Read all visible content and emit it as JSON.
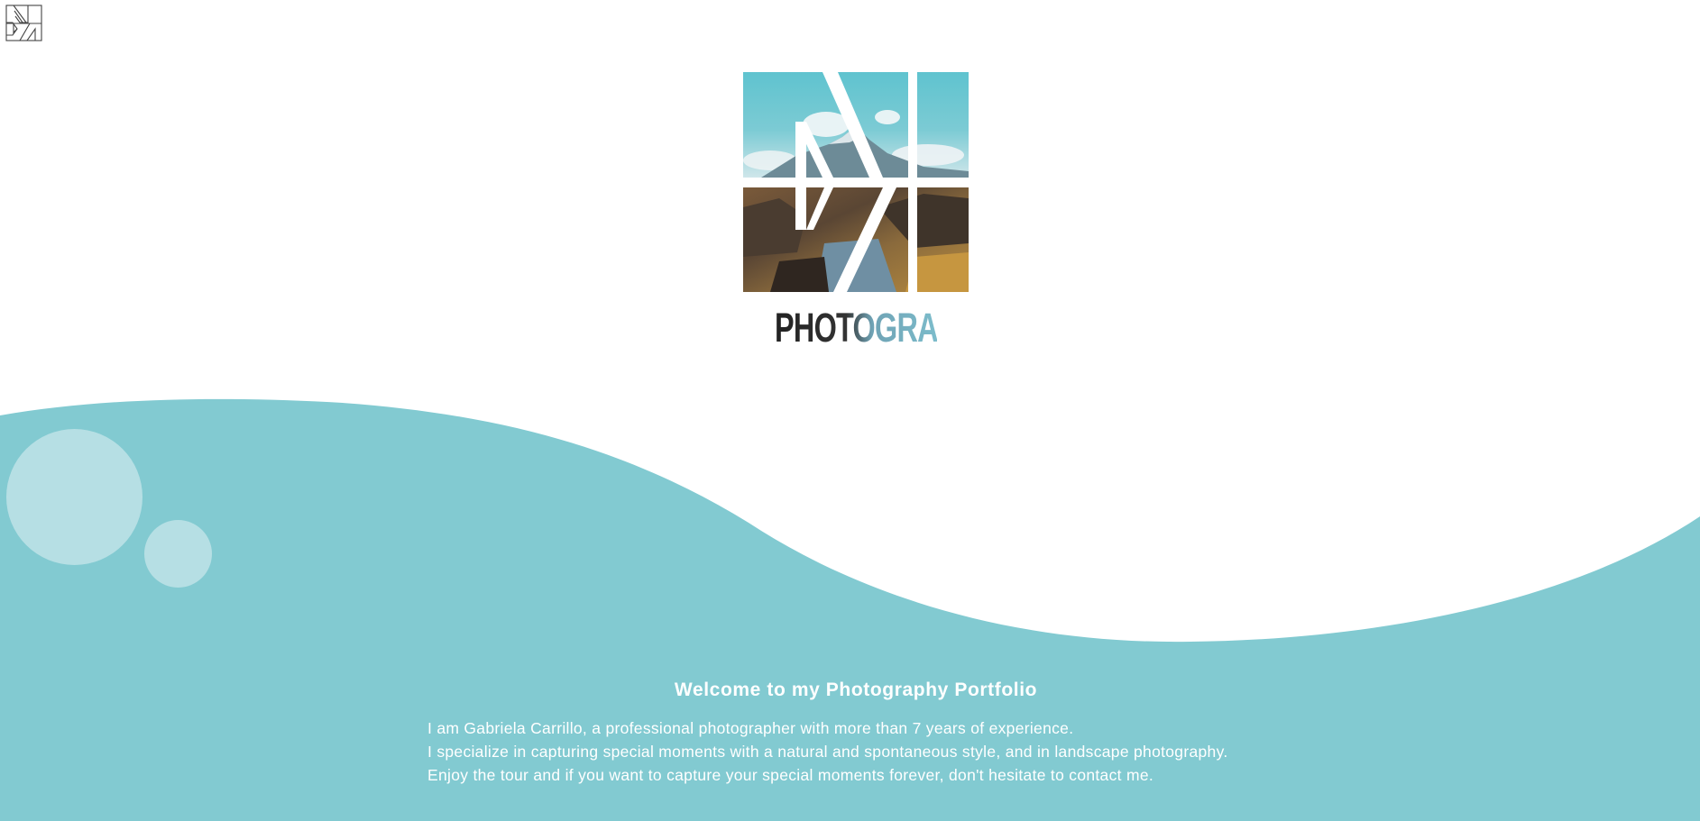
{
  "brand": {
    "corner_logo_icon": "brand-monogram-icon",
    "main_logo_icon": "photo-logo-icon",
    "wordmark": "PHOTOGRAPHY"
  },
  "welcome": {
    "title": "Welcome to my Photography Portfolio",
    "lines": [
      "I am Gabriela Carrillo, a professional photographer with more than 7 years of experience.",
      "I specialize in capturing special moments with a natural and spontaneous style, and in landscape photography.",
      "Enjoy the tour and if you want to capture your special moments forever, don't hesitate to contact me."
    ]
  },
  "colors": {
    "accent": "#82cad1",
    "bubble": "#b6dfe4",
    "text_on_accent": "#ffffff",
    "wordmark_dark": "#333333",
    "wordmark_light": "#7cbccb"
  }
}
